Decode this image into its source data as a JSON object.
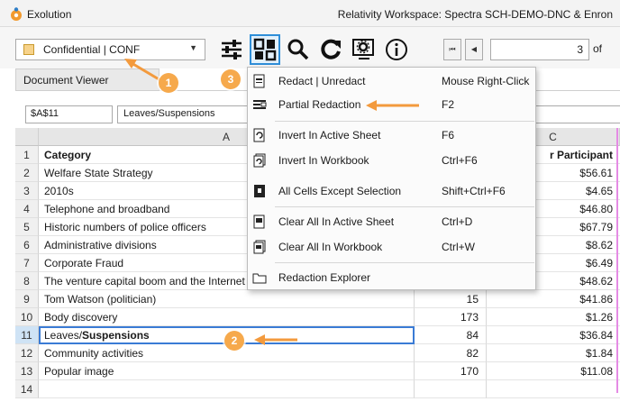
{
  "titlebar": {
    "app_name": "Exolution",
    "workspace": "Relativity Workspace: Spectra SCH-DEMO-DNC & Enron"
  },
  "toolbar": {
    "confidentiality": "Confidential | CONF",
    "tools": [
      "sliders-icon",
      "redaction-icon",
      "search-icon",
      "refresh-icon",
      "settings-icon",
      "info-icon"
    ]
  },
  "pager": {
    "first_label": "⏮",
    "prev_label": "◀",
    "page": "3",
    "of_text": "of"
  },
  "panel": {
    "tab_label": "Document Viewer"
  },
  "formula": {
    "cell_ref": "$A$11",
    "value": "Leaves/Suspensions"
  },
  "grid": {
    "column_headers": [
      "A",
      "B",
      "C"
    ],
    "rows": [
      {
        "n": "1",
        "a": "Category",
        "b": "",
        "c": "r Participant",
        "header": true
      },
      {
        "n": "2",
        "a": "Welfare State Strategy",
        "b": "",
        "c": "$56.61"
      },
      {
        "n": "3",
        "a": "2010s",
        "b": "",
        "c": "$4.65"
      },
      {
        "n": "4",
        "a": "Telephone and broadband",
        "b": "",
        "c": "$46.80"
      },
      {
        "n": "5",
        "a": "Historic numbers of police officers",
        "b": "",
        "c": "$67.79"
      },
      {
        "n": "6",
        "a": "Administrative divisions",
        "b": "",
        "c": "$8.62"
      },
      {
        "n": "7",
        "a": "Corporate Fraud",
        "b": "",
        "c": "$6.49"
      },
      {
        "n": "8",
        "a": "The venture capital boom and the Internet Bubble (1995 to 2000)",
        "b": "155",
        "c": "$48.62"
      },
      {
        "n": "9",
        "a": "Tom Watson (politician)",
        "b": "15",
        "c": "$41.86"
      },
      {
        "n": "10",
        "a": "Body discovery",
        "b": "173",
        "c": "$1.26"
      },
      {
        "n": "11",
        "a": "Leaves/",
        "a_bold": "Suspensions",
        "b": "84",
        "c": "$36.84"
      },
      {
        "n": "12",
        "a": "Community activities",
        "b": "82",
        "c": "$1.84"
      },
      {
        "n": "13",
        "a": "Popular image",
        "b": "170",
        "c": "$11.08"
      },
      {
        "n": "14",
        "a": "",
        "b": "",
        "c": ""
      }
    ]
  },
  "menu": {
    "items": [
      {
        "label": "Redact | Unredact",
        "shortcut": "Mouse Right-Click"
      },
      {
        "label": "Partial Redaction",
        "shortcut": "F2"
      },
      {
        "label": "Invert In Active Sheet",
        "shortcut": "F6"
      },
      {
        "label": "Invert In Workbook",
        "shortcut": "Ctrl+F6"
      },
      {
        "label": "All Cells Except Selection",
        "shortcut": "Shift+Ctrl+F6"
      },
      {
        "label": "Clear All In Active Sheet",
        "shortcut": "Ctrl+D"
      },
      {
        "label": "Clear All In Workbook",
        "shortcut": "Ctrl+W"
      },
      {
        "label": "Redaction Explorer",
        "shortcut": ""
      }
    ]
  },
  "callouts": [
    "1",
    "2",
    "3"
  ],
  "colors": {
    "accent": "#2f8ed8",
    "callout": "#f6a94c",
    "arrow": "#f39a3d",
    "selection": "#3a7bd5"
  }
}
